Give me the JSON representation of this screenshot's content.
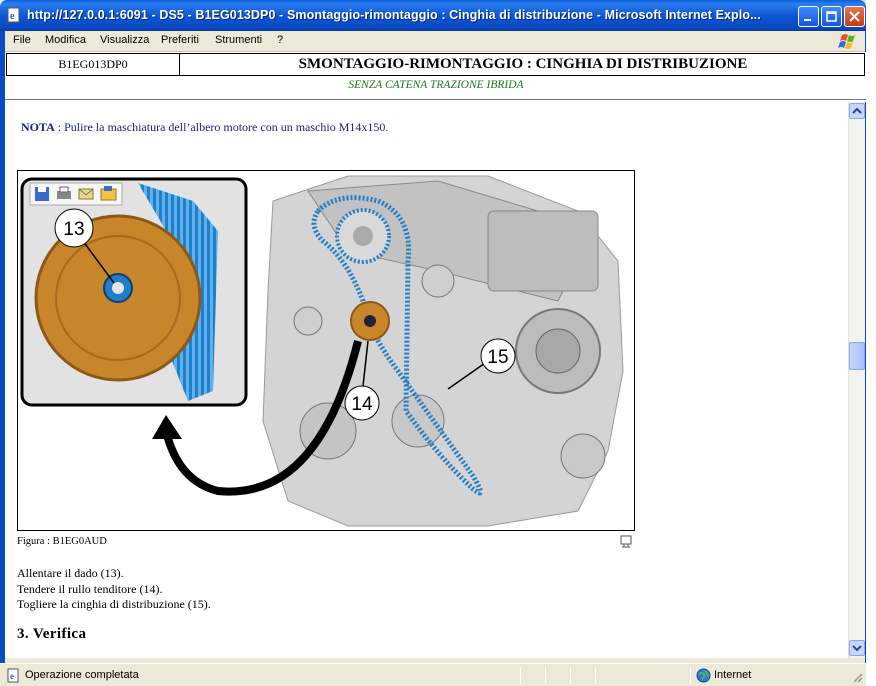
{
  "window": {
    "title": "http://127.0.0.1:6091 - DS5 - B1EG013DP0 - Smontaggio-rimontaggio : Cinghia di distribuzione - Microsoft Internet Explo..."
  },
  "menu": [
    "File",
    "Modifica",
    "Visualizza",
    "Preferiti",
    "Strumenti",
    "?"
  ],
  "header": {
    "code": "B1EG013DP0",
    "title": "SMONTAGGIO-RIMONTAGGIO : CINGHIA DI DISTRIBUZIONE",
    "subtitle": "SENZA CATENA TRAZIONE IBRIDA"
  },
  "nota": {
    "label": "NOTA",
    "text": " : Pulire la maschiatura dell’albero motore con un maschio M14x150."
  },
  "figure": {
    "callouts": [
      "13",
      "14",
      "15"
    ],
    "caption": "Figura : B1EG0AUD"
  },
  "instructions": [
    "Allentare il dado (13).",
    "Tendere il rullo tenditore (14).",
    "Togliere la cinghia di distribuzione (15)."
  ],
  "section": "3. Verifica",
  "status": {
    "message": "Operazione completata",
    "zone": "Internet"
  },
  "colors": {
    "titlebar": "#0d56d6",
    "subtitle": "#177a17",
    "nota": "#1a1a8c",
    "belt": "#1f7fc8",
    "pulley": "#c9852a"
  }
}
